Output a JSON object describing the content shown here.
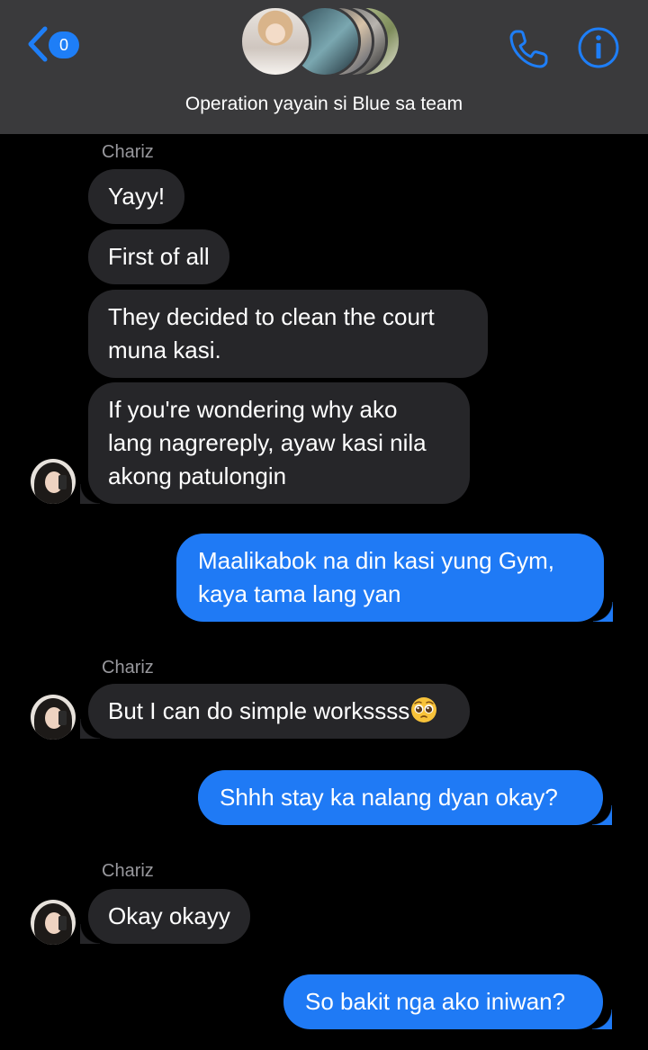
{
  "header": {
    "unread_count": "0",
    "title": "Operation yayain si Blue sa team",
    "accent_color": "#1e7ef7",
    "icons": [
      "back-chevron-icon",
      "group-avatar-stack",
      "phone-icon",
      "info-icon"
    ]
  },
  "messages": [
    {
      "type": "name",
      "text": "Chariz"
    },
    {
      "type": "in",
      "text": "Yayy!"
    },
    {
      "type": "in",
      "text": "First of all"
    },
    {
      "type": "in",
      "lines": [
        "They decided to clean the court",
        "muna kasi."
      ]
    },
    {
      "type": "in",
      "lines": [
        "If you're wondering why ako",
        "lang nagrereply, ayaw kasi nila",
        "akong patulongin"
      ]
    },
    {
      "type": "out",
      "lines": [
        "Maalikabok na din kasi yung Gym,",
        "kaya tama lang yan"
      ]
    },
    {
      "type": "name",
      "text": "Chariz"
    },
    {
      "type": "in",
      "text": "But I can do simple workssss",
      "emoji": "pleading-face-emoji"
    },
    {
      "type": "out",
      "text": "Shhh stay ka nalang dyan okay?"
    },
    {
      "type": "name",
      "text": "Chariz"
    },
    {
      "type": "in",
      "text": "Okay okayy"
    },
    {
      "type": "out",
      "text": "So bakit nga ako iniwan?"
    }
  ]
}
